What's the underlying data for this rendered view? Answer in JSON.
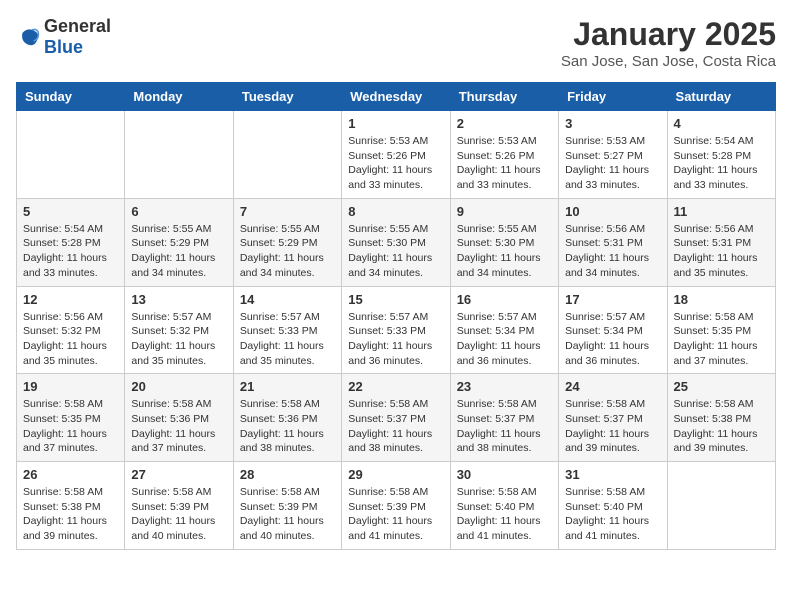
{
  "logo": {
    "text_general": "General",
    "text_blue": "Blue"
  },
  "header": {
    "month_title": "January 2025",
    "location": "San Jose, San Jose, Costa Rica"
  },
  "weekdays": [
    "Sunday",
    "Monday",
    "Tuesday",
    "Wednesday",
    "Thursday",
    "Friday",
    "Saturday"
  ],
  "weeks": [
    [
      {
        "day": "",
        "sunrise": "",
        "sunset": "",
        "daylight": ""
      },
      {
        "day": "",
        "sunrise": "",
        "sunset": "",
        "daylight": ""
      },
      {
        "day": "",
        "sunrise": "",
        "sunset": "",
        "daylight": ""
      },
      {
        "day": "1",
        "sunrise": "Sunrise: 5:53 AM",
        "sunset": "Sunset: 5:26 PM",
        "daylight": "Daylight: 11 hours and 33 minutes."
      },
      {
        "day": "2",
        "sunrise": "Sunrise: 5:53 AM",
        "sunset": "Sunset: 5:26 PM",
        "daylight": "Daylight: 11 hours and 33 minutes."
      },
      {
        "day": "3",
        "sunrise": "Sunrise: 5:53 AM",
        "sunset": "Sunset: 5:27 PM",
        "daylight": "Daylight: 11 hours and 33 minutes."
      },
      {
        "day": "4",
        "sunrise": "Sunrise: 5:54 AM",
        "sunset": "Sunset: 5:28 PM",
        "daylight": "Daylight: 11 hours and 33 minutes."
      }
    ],
    [
      {
        "day": "5",
        "sunrise": "Sunrise: 5:54 AM",
        "sunset": "Sunset: 5:28 PM",
        "daylight": "Daylight: 11 hours and 33 minutes."
      },
      {
        "day": "6",
        "sunrise": "Sunrise: 5:55 AM",
        "sunset": "Sunset: 5:29 PM",
        "daylight": "Daylight: 11 hours and 34 minutes."
      },
      {
        "day": "7",
        "sunrise": "Sunrise: 5:55 AM",
        "sunset": "Sunset: 5:29 PM",
        "daylight": "Daylight: 11 hours and 34 minutes."
      },
      {
        "day": "8",
        "sunrise": "Sunrise: 5:55 AM",
        "sunset": "Sunset: 5:30 PM",
        "daylight": "Daylight: 11 hours and 34 minutes."
      },
      {
        "day": "9",
        "sunrise": "Sunrise: 5:55 AM",
        "sunset": "Sunset: 5:30 PM",
        "daylight": "Daylight: 11 hours and 34 minutes."
      },
      {
        "day": "10",
        "sunrise": "Sunrise: 5:56 AM",
        "sunset": "Sunset: 5:31 PM",
        "daylight": "Daylight: 11 hours and 34 minutes."
      },
      {
        "day": "11",
        "sunrise": "Sunrise: 5:56 AM",
        "sunset": "Sunset: 5:31 PM",
        "daylight": "Daylight: 11 hours and 35 minutes."
      }
    ],
    [
      {
        "day": "12",
        "sunrise": "Sunrise: 5:56 AM",
        "sunset": "Sunset: 5:32 PM",
        "daylight": "Daylight: 11 hours and 35 minutes."
      },
      {
        "day": "13",
        "sunrise": "Sunrise: 5:57 AM",
        "sunset": "Sunset: 5:32 PM",
        "daylight": "Daylight: 11 hours and 35 minutes."
      },
      {
        "day": "14",
        "sunrise": "Sunrise: 5:57 AM",
        "sunset": "Sunset: 5:33 PM",
        "daylight": "Daylight: 11 hours and 35 minutes."
      },
      {
        "day": "15",
        "sunrise": "Sunrise: 5:57 AM",
        "sunset": "Sunset: 5:33 PM",
        "daylight": "Daylight: 11 hours and 36 minutes."
      },
      {
        "day": "16",
        "sunrise": "Sunrise: 5:57 AM",
        "sunset": "Sunset: 5:34 PM",
        "daylight": "Daylight: 11 hours and 36 minutes."
      },
      {
        "day": "17",
        "sunrise": "Sunrise: 5:57 AM",
        "sunset": "Sunset: 5:34 PM",
        "daylight": "Daylight: 11 hours and 36 minutes."
      },
      {
        "day": "18",
        "sunrise": "Sunrise: 5:58 AM",
        "sunset": "Sunset: 5:35 PM",
        "daylight": "Daylight: 11 hours and 37 minutes."
      }
    ],
    [
      {
        "day": "19",
        "sunrise": "Sunrise: 5:58 AM",
        "sunset": "Sunset: 5:35 PM",
        "daylight": "Daylight: 11 hours and 37 minutes."
      },
      {
        "day": "20",
        "sunrise": "Sunrise: 5:58 AM",
        "sunset": "Sunset: 5:36 PM",
        "daylight": "Daylight: 11 hours and 37 minutes."
      },
      {
        "day": "21",
        "sunrise": "Sunrise: 5:58 AM",
        "sunset": "Sunset: 5:36 PM",
        "daylight": "Daylight: 11 hours and 38 minutes."
      },
      {
        "day": "22",
        "sunrise": "Sunrise: 5:58 AM",
        "sunset": "Sunset: 5:37 PM",
        "daylight": "Daylight: 11 hours and 38 minutes."
      },
      {
        "day": "23",
        "sunrise": "Sunrise: 5:58 AM",
        "sunset": "Sunset: 5:37 PM",
        "daylight": "Daylight: 11 hours and 38 minutes."
      },
      {
        "day": "24",
        "sunrise": "Sunrise: 5:58 AM",
        "sunset": "Sunset: 5:37 PM",
        "daylight": "Daylight: 11 hours and 39 minutes."
      },
      {
        "day": "25",
        "sunrise": "Sunrise: 5:58 AM",
        "sunset": "Sunset: 5:38 PM",
        "daylight": "Daylight: 11 hours and 39 minutes."
      }
    ],
    [
      {
        "day": "26",
        "sunrise": "Sunrise: 5:58 AM",
        "sunset": "Sunset: 5:38 PM",
        "daylight": "Daylight: 11 hours and 39 minutes."
      },
      {
        "day": "27",
        "sunrise": "Sunrise: 5:58 AM",
        "sunset": "Sunset: 5:39 PM",
        "daylight": "Daylight: 11 hours and 40 minutes."
      },
      {
        "day": "28",
        "sunrise": "Sunrise: 5:58 AM",
        "sunset": "Sunset: 5:39 PM",
        "daylight": "Daylight: 11 hours and 40 minutes."
      },
      {
        "day": "29",
        "sunrise": "Sunrise: 5:58 AM",
        "sunset": "Sunset: 5:39 PM",
        "daylight": "Daylight: 11 hours and 41 minutes."
      },
      {
        "day": "30",
        "sunrise": "Sunrise: 5:58 AM",
        "sunset": "Sunset: 5:40 PM",
        "daylight": "Daylight: 11 hours and 41 minutes."
      },
      {
        "day": "31",
        "sunrise": "Sunrise: 5:58 AM",
        "sunset": "Sunset: 5:40 PM",
        "daylight": "Daylight: 11 hours and 41 minutes."
      },
      {
        "day": "",
        "sunrise": "",
        "sunset": "",
        "daylight": ""
      }
    ]
  ]
}
